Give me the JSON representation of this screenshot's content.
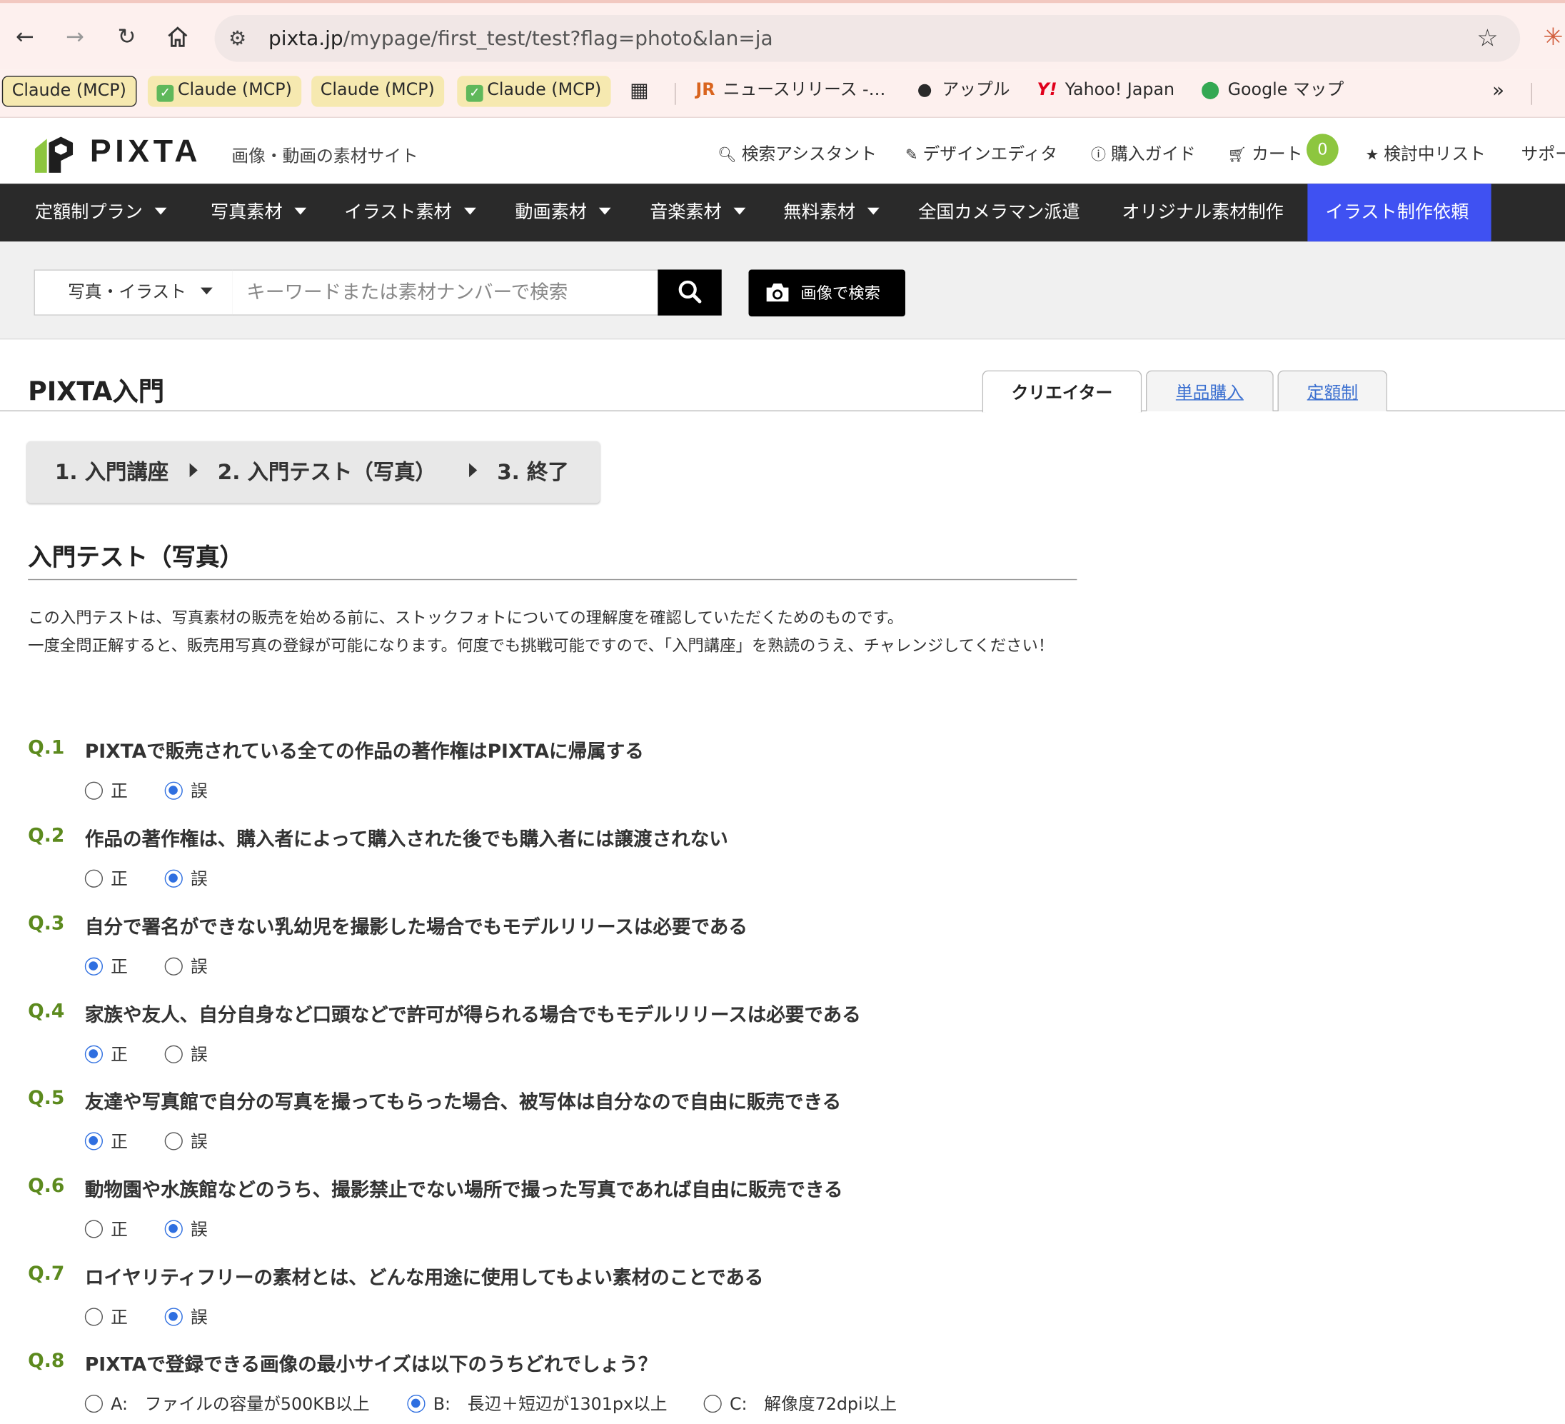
{
  "browser": {
    "url_host": "pixta.jp",
    "url_path": "/mypage/first_test/test?flag=photo&lan=ja",
    "bookmarks": [
      {
        "label": "Claude (MCP)",
        "check": false
      },
      {
        "label": "Claude (MCP)",
        "check": true
      },
      {
        "label": "Claude (MCP)",
        "check": false
      },
      {
        "label": "Claude (MCP)",
        "check": true
      },
      {
        "label": "ニュースリリース -…",
        "icon": "jr-icon"
      },
      {
        "label": "アップル",
        "icon": "apple-icon"
      },
      {
        "label": "Yahoo! Japan",
        "icon": "yahoo-icon"
      },
      {
        "label": "Google マップ",
        "icon": "maps-icon"
      }
    ],
    "overflow_label": "»"
  },
  "header": {
    "logo": "PIXTA",
    "tagline": "画像・動画の素材サイト",
    "links": {
      "assistant": "検索アシスタント",
      "design_editor": "デザインエディタ",
      "guide": "購入ガイド",
      "cart": "カート",
      "cart_count": "0",
      "wishlist": "検討中リスト",
      "support": "サポー"
    }
  },
  "nav": {
    "plan": "定額制プラン",
    "photo": "写真素材",
    "illust": "イラスト素材",
    "video": "動画素材",
    "music": "音楽素材",
    "free": "無料素材",
    "camera": "全国カメラマン派遣",
    "original": "オリジナル素材制作",
    "request": "イラスト制作依頼"
  },
  "search": {
    "category": "写真・イラスト",
    "placeholder": "キーワードまたは素材ナンバーで検索",
    "image_search": "画像で検索"
  },
  "page": {
    "title": "PIXTA入門",
    "tabs": {
      "creator": "クリエイター",
      "single": "単品購入",
      "subscription": "定額制"
    },
    "steps": {
      "s1": "1. 入門講座",
      "s2": "2. 入門テスト（写真）",
      "s3": "3. 終了"
    },
    "section_title": "入門テスト（写真）",
    "intro_line1": "この入門テストは、写真素材の販売を始める前に、ストックフォトについての理解度を確認していただくためのものです。",
    "intro_line2": "一度全問正解すると、販売用写真の登録が可能になります。何度でも挑戦可能ですので、「入門講座」を熟読のうえ、チャレンジしてください！"
  },
  "questions": [
    {
      "num": "Q.1",
      "text": "PIXTAで販売されている全ての作品の著作権はPIXTAに帰属する",
      "options": [
        "正",
        "誤"
      ],
      "selected": 1
    },
    {
      "num": "Q.2",
      "text": "作品の著作権は、購入者によって購入された後でも購入者には譲渡されない",
      "options": [
        "正",
        "誤"
      ],
      "selected": 1
    },
    {
      "num": "Q.3",
      "text": "自分で署名ができない乳幼児を撮影した場合でもモデルリリースは必要である",
      "options": [
        "正",
        "誤"
      ],
      "selected": 0
    },
    {
      "num": "Q.4",
      "text": "家族や友人、自分自身など口頭などで許可が得られる場合でもモデルリリースは必要である",
      "options": [
        "正",
        "誤"
      ],
      "selected": 0
    },
    {
      "num": "Q.5",
      "text": "友達や写真館で自分の写真を撮ってもらった場合、被写体は自分なので自由に販売できる",
      "options": [
        "正",
        "誤"
      ],
      "selected": 0
    },
    {
      "num": "Q.6",
      "text": "動物園や水族館などのうち、撮影禁止でない場所で撮った写真であれば自由に販売できる",
      "options": [
        "正",
        "誤"
      ],
      "selected": 1
    },
    {
      "num": "Q.7",
      "text": "ロイヤリティフリーの素材とは、どんな用途に使用してもよい素材のことである",
      "options": [
        "正",
        "誤"
      ],
      "selected": 1
    },
    {
      "num": "Q.8",
      "text": "PIXTAで登録できる画像の最小サイズは以下のうちどれでしょう？",
      "options": [
        "A:　ファイルの容量が500KB以上",
        "B:　長辺＋短辺が1301px以上",
        "C:　解像度72dpi以上"
      ],
      "selected": 1
    }
  ],
  "colors": {
    "accent_nav": "#3f51f2",
    "qnum_green": "#5c8a1e",
    "radio_blue": "#2f6fe0",
    "cart_green": "#8dc63f"
  }
}
